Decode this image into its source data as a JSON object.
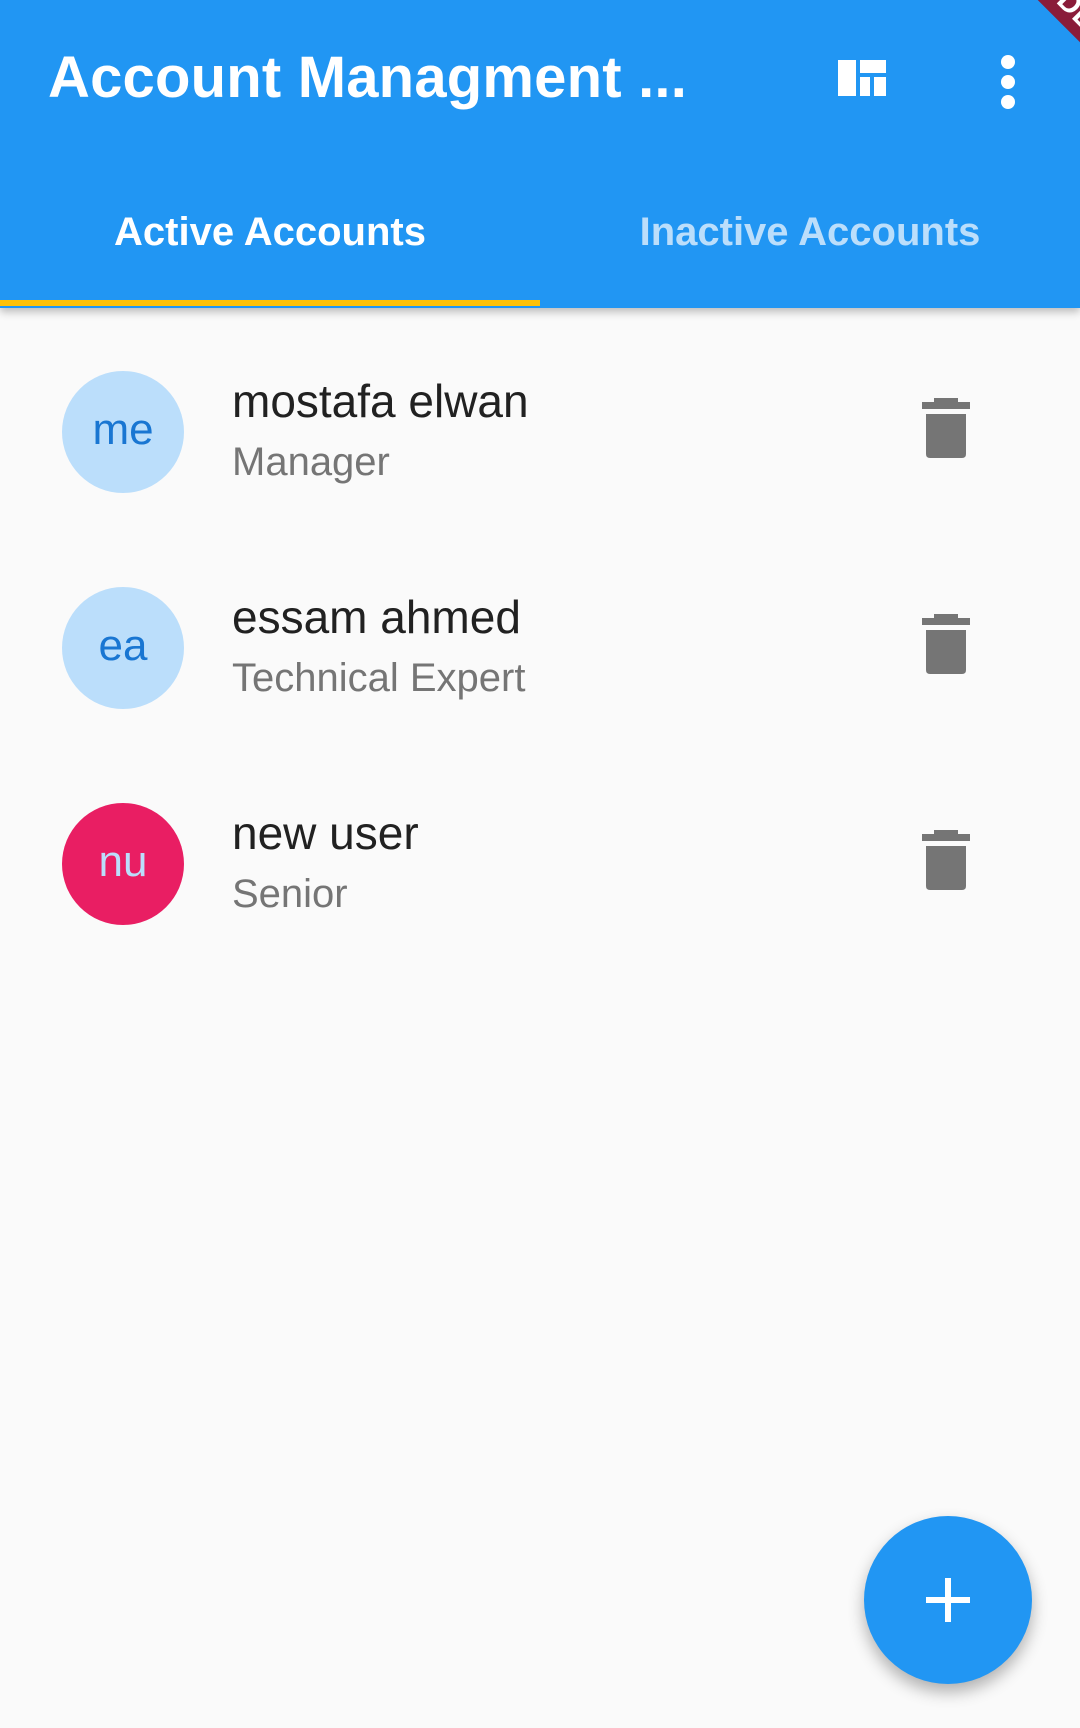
{
  "appbar": {
    "title": "Account Managment ...",
    "actions": [
      {
        "icon": "dashboard-icon"
      },
      {
        "icon": "more-vert-icon"
      }
    ],
    "color": "#2196f3"
  },
  "debug_banner": {
    "label": "DEBUG"
  },
  "tabs": [
    {
      "label": "Active Accounts",
      "selected": true
    },
    {
      "label": "Inactive Accounts",
      "selected": false
    }
  ],
  "accounts": [
    {
      "initials": "me",
      "name": "mostafa elwan",
      "role": "Manager",
      "avatar_color": "#bbdefb"
    },
    {
      "initials": "ea",
      "name": "essam ahmed",
      "role": "Technical Expert",
      "avatar_color": "#bbdefb"
    },
    {
      "initials": "nu",
      "name": "new user",
      "role": "Senior",
      "avatar_color": "#e91e63"
    }
  ],
  "fab": {
    "icon": "add-icon"
  },
  "colors": {
    "primary": "#2196f3",
    "indicator": "#ffc107",
    "delete_icon": "#757575"
  }
}
